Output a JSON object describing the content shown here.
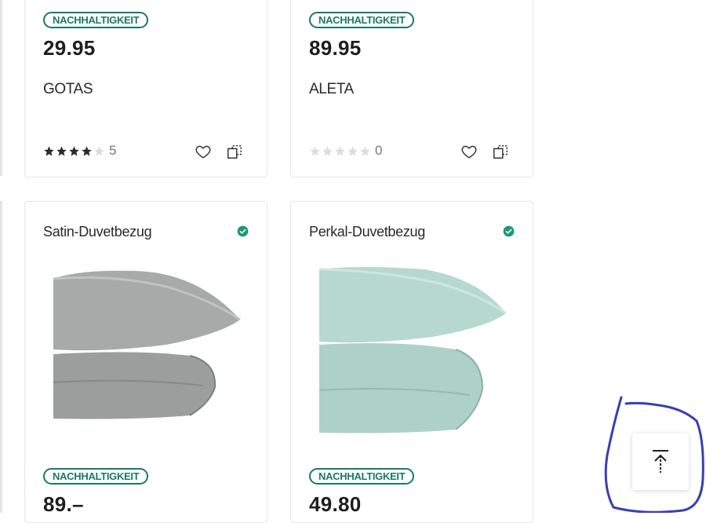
{
  "products_top": [
    {
      "badge": "NACHHALTIGKEIT",
      "price": "29.95",
      "name": "GOTAS",
      "rating": 4,
      "review_count": "5"
    },
    {
      "badge": "NACHHALTIGKEIT",
      "price": "89.95",
      "name": "ALETA",
      "rating": 0,
      "review_count": "0"
    }
  ],
  "products_bottom": [
    {
      "title": "Satin-Duvetbezug",
      "badge": "NACHHALTIGKEIT",
      "price": "89.–",
      "image_color": "#a3a8a6"
    },
    {
      "title": "Perkal-Duvetbezug",
      "badge": "NACHHALTIGKEIT",
      "price": "49.80",
      "image_color": "#b5d6cc"
    }
  ],
  "icons": {
    "wishlist": "heart-icon",
    "compare": "compare-icon",
    "available": "check-circle-icon",
    "scroll_top": "arrow-to-top-icon"
  },
  "colors": {
    "accent": "#1a7a62",
    "star_filled": "#2b2b2b",
    "star_empty": "#dcdcdc",
    "annotation": "#3a3fb0"
  }
}
